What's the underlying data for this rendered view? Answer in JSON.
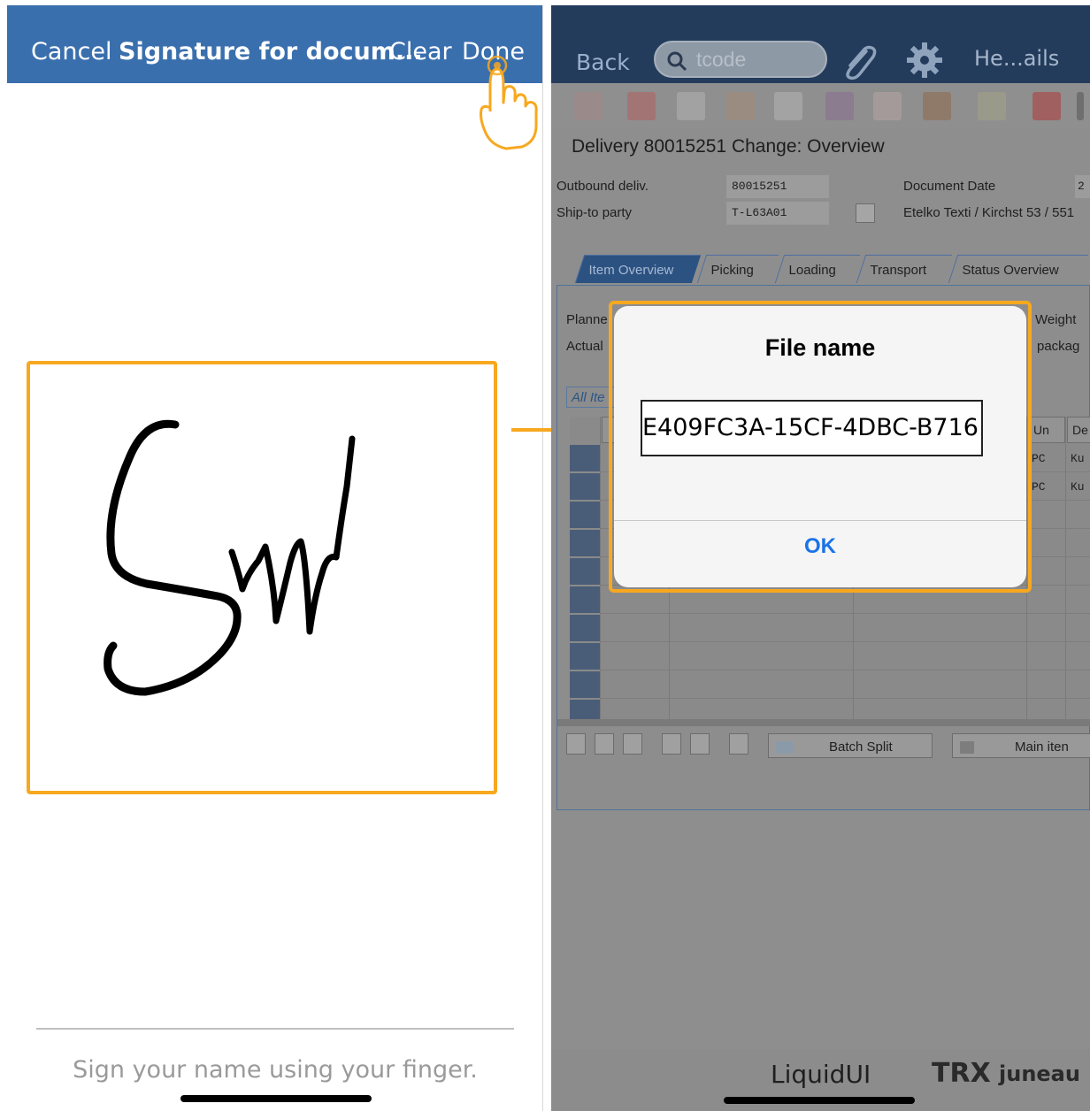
{
  "signature_screen": {
    "cancel_label": "Cancel",
    "title": "Signature for docum...",
    "clear_label": "Clear",
    "done_label": "Done",
    "hint": "Sign your name using your finger."
  },
  "sap": {
    "back_label": "Back",
    "search_placeholder": "tcode",
    "help_label": "He...ails",
    "page_title": "Delivery 80015251 Change: Overview",
    "fields": {
      "outbound_label": "Outbound deliv.",
      "outbound_value": "80015251",
      "shipto_label": "Ship-to party",
      "shipto_value": "T-L63A01",
      "docdate_label": "Document Date",
      "docdate_value": "2",
      "address": "Etelko Texti / Kirchst 53 / 551"
    },
    "tabs": [
      "Item Overview",
      "Picking",
      "Loading",
      "Transport",
      "Status Overview"
    ],
    "panel": {
      "planned_label": "Planne",
      "actual_label": "Actual",
      "weight_label": "Weight",
      "package_label": "packag",
      "all_items_label": "All Ite",
      "col_un": "Un",
      "col_de": "De",
      "row1_un": "PC",
      "row1_de": "Ku",
      "row2_un": "PC",
      "row2_de": "Ku"
    },
    "batch_split_label": "Batch Split",
    "main_item_label": "Main iten",
    "brand_liquid": "LiquidUI",
    "brand_trx": "TRX",
    "brand_juneau": "juneau"
  },
  "dialog": {
    "title": "File name",
    "input_value": "E409FC3A-15CF-4DBC-B716...",
    "ok_label": "OK"
  },
  "colors": {
    "highlight": "#f7a81f",
    "signature_header": "#3a6fae",
    "ok_blue": "#1a73e8"
  }
}
